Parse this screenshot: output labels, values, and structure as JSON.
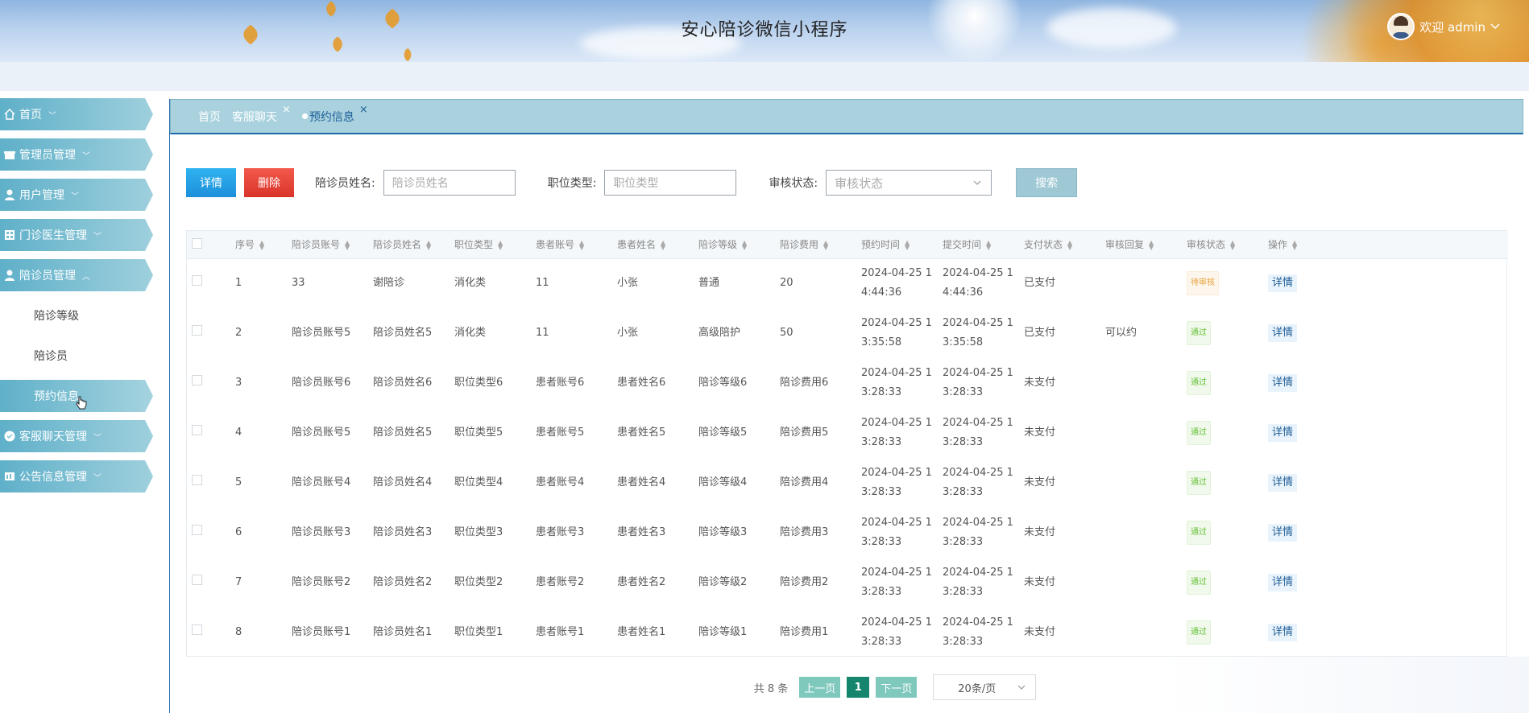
{
  "header": {
    "title": "安心陪诊微信小程序",
    "welcome": "欢迎 admin",
    "dropdown_icon": "chevron-down"
  },
  "sidebar": {
    "items": [
      {
        "label": "首页",
        "icon": "home-icon",
        "chevron": "﹀"
      },
      {
        "label": "管理员管理",
        "icon": "gift-icon",
        "chevron": "﹀"
      },
      {
        "label": "用户管理",
        "icon": "user-icon",
        "chevron": "﹀"
      },
      {
        "label": "门诊医生管理",
        "icon": "grid-icon",
        "chevron": "﹀"
      },
      {
        "label": "陪诊员管理",
        "icon": "user-icon",
        "chevron": "︿"
      },
      {
        "label": "客服聊天管理",
        "icon": "check-circle-icon",
        "chevron": "﹀"
      },
      {
        "label": "公告信息管理",
        "icon": "notice-icon",
        "chevron": "﹀"
      }
    ],
    "subitems": [
      "陪诊等级",
      "陪诊员",
      "预约信息"
    ]
  },
  "tabs": [
    {
      "label": "首页"
    },
    {
      "label": "客服聊天",
      "close": "×"
    },
    {
      "label": "预约信息",
      "close": "×"
    }
  ],
  "toolbar": {
    "detail_label": "详情",
    "delete_label": "删除",
    "name_label": "陪诊员姓名:",
    "name_placeholder": "陪诊员姓名",
    "type_label": "职位类型:",
    "type_placeholder": "职位类型",
    "status_label": "审核状态:",
    "status_placeholder": "审核状态",
    "search_label": "搜索"
  },
  "table": {
    "columns": [
      "序号",
      "陪诊员账号",
      "陪诊员姓名",
      "职位类型",
      "患者账号",
      "患者姓名",
      "陪诊等级",
      "陪诊费用",
      "预约时间",
      "提交时间",
      "支付状态",
      "审核回复",
      "审核状态",
      "操作"
    ],
    "rows": [
      {
        "no": "1",
        "account": "33",
        "name": "谢陪诊",
        "type": "消化类",
        "patient_account": "11",
        "patient_name": "小张",
        "level": "普通",
        "fee": "20",
        "book_time": "2024-04-25 1",
        "book_time2": "4:44:36",
        "submit_time": "2024-04-25 1",
        "submit_time2": "4:44:36",
        "pay": "已支付",
        "reply": "",
        "status": "待审核",
        "status_type": "pending",
        "op": "详情"
      },
      {
        "no": "2",
        "account": "陪诊员账号5",
        "name": "陪诊员姓名5",
        "type": "消化类",
        "patient_account": "11",
        "patient_name": "小张",
        "level": "高级陪护",
        "fee": "50",
        "book_time": "2024-04-25 1",
        "book_time2": "3:35:58",
        "submit_time": "2024-04-25 1",
        "submit_time2": "3:35:58",
        "pay": "已支付",
        "reply": "可以约",
        "status": "通过",
        "status_type": "pass",
        "op": "详情"
      },
      {
        "no": "3",
        "account": "陪诊员账号6",
        "name": "陪诊员姓名6",
        "type": "职位类型6",
        "patient_account": "患者账号6",
        "patient_name": "患者姓名6",
        "level": "陪诊等级6",
        "fee": "陪诊费用6",
        "book_time": "2024-04-25 1",
        "book_time2": "3:28:33",
        "submit_time": "2024-04-25 1",
        "submit_time2": "3:28:33",
        "pay": "未支付",
        "reply": "",
        "status": "通过",
        "status_type": "pass",
        "op": "详情"
      },
      {
        "no": "4",
        "account": "陪诊员账号5",
        "name": "陪诊员姓名5",
        "type": "职位类型5",
        "patient_account": "患者账号5",
        "patient_name": "患者姓名5",
        "level": "陪诊等级5",
        "fee": "陪诊费用5",
        "book_time": "2024-04-25 1",
        "book_time2": "3:28:33",
        "submit_time": "2024-04-25 1",
        "submit_time2": "3:28:33",
        "pay": "未支付",
        "reply": "",
        "status": "通过",
        "status_type": "pass",
        "op": "详情"
      },
      {
        "no": "5",
        "account": "陪诊员账号4",
        "name": "陪诊员姓名4",
        "type": "职位类型4",
        "patient_account": "患者账号4",
        "patient_name": "患者姓名4",
        "level": "陪诊等级4",
        "fee": "陪诊费用4",
        "book_time": "2024-04-25 1",
        "book_time2": "3:28:33",
        "submit_time": "2024-04-25 1",
        "submit_time2": "3:28:33",
        "pay": "未支付",
        "reply": "",
        "status": "通过",
        "status_type": "pass",
        "op": "详情"
      },
      {
        "no": "6",
        "account": "陪诊员账号3",
        "name": "陪诊员姓名3",
        "type": "职位类型3",
        "patient_account": "患者账号3",
        "patient_name": "患者姓名3",
        "level": "陪诊等级3",
        "fee": "陪诊费用3",
        "book_time": "2024-04-25 1",
        "book_time2": "3:28:33",
        "submit_time": "2024-04-25 1",
        "submit_time2": "3:28:33",
        "pay": "未支付",
        "reply": "",
        "status": "通过",
        "status_type": "pass",
        "op": "详情"
      },
      {
        "no": "7",
        "account": "陪诊员账号2",
        "name": "陪诊员姓名2",
        "type": "职位类型2",
        "patient_account": "患者账号2",
        "patient_name": "患者姓名2",
        "level": "陪诊等级2",
        "fee": "陪诊费用2",
        "book_time": "2024-04-25 1",
        "book_time2": "3:28:33",
        "submit_time": "2024-04-25 1",
        "submit_time2": "3:28:33",
        "pay": "未支付",
        "reply": "",
        "status": "通过",
        "status_type": "pass",
        "op": "详情"
      },
      {
        "no": "8",
        "account": "陪诊员账号1",
        "name": "陪诊员姓名1",
        "type": "职位类型1",
        "patient_account": "患者账号1",
        "patient_name": "患者姓名1",
        "level": "陪诊等级1",
        "fee": "陪诊费用1",
        "book_time": "2024-04-25 1",
        "book_time2": "3:28:33",
        "submit_time": "2024-04-25 1",
        "submit_time2": "3:28:33",
        "pay": "未支付",
        "reply": "",
        "status": "通过",
        "status_type": "pass",
        "op": "详情"
      }
    ]
  },
  "pagination": {
    "total": "共 8 条",
    "prev": "上一页",
    "current": "1",
    "next": "下一页",
    "page_size": "20条/页"
  },
  "colors": {
    "menu": "#5fb0c9",
    "accent": "#1f5e98",
    "detail_button": "#1d8fdb",
    "delete_button": "#d9332a",
    "pager_active": "#15856d"
  }
}
